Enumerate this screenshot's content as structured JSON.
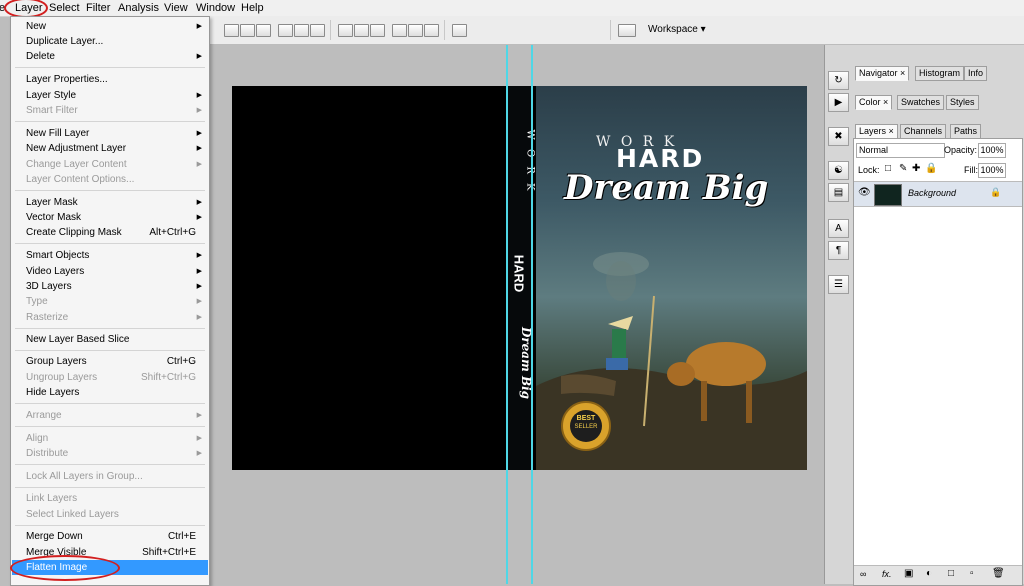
{
  "menubar": {
    "items": [
      "e",
      "Layer",
      "Select",
      "Filter",
      "Analysis",
      "View",
      "Window",
      "Help"
    ],
    "highlight_color": "#d21f1f"
  },
  "optionsbar": {
    "workspace_label": "Workspace ▾"
  },
  "layer_menu": {
    "items": [
      {
        "label": "New",
        "shortcut": "",
        "arrow": true,
        "disabled": false
      },
      {
        "label": "Duplicate Layer...",
        "shortcut": "",
        "arrow": false,
        "disabled": false
      },
      {
        "label": "Delete",
        "shortcut": "",
        "arrow": true,
        "disabled": false
      },
      {
        "label": "Layer Properties...",
        "shortcut": "",
        "arrow": false,
        "disabled": false
      },
      {
        "label": "Layer Style",
        "shortcut": "",
        "arrow": true,
        "disabled": false
      },
      {
        "label": "Smart Filter",
        "shortcut": "",
        "arrow": true,
        "disabled": true
      },
      {
        "label": "New Fill Layer",
        "shortcut": "",
        "arrow": true,
        "disabled": false
      },
      {
        "label": "New Adjustment Layer",
        "shortcut": "",
        "arrow": true,
        "disabled": false
      },
      {
        "label": "Change Layer Content",
        "shortcut": "",
        "arrow": true,
        "disabled": true
      },
      {
        "label": "Layer Content Options...",
        "shortcut": "",
        "arrow": false,
        "disabled": true
      },
      {
        "label": "Layer Mask",
        "shortcut": "",
        "arrow": true,
        "disabled": false
      },
      {
        "label": "Vector Mask",
        "shortcut": "",
        "arrow": true,
        "disabled": false
      },
      {
        "label": "Create Clipping Mask",
        "shortcut": "Alt+Ctrl+G",
        "arrow": false,
        "disabled": false
      },
      {
        "label": "Smart Objects",
        "shortcut": "",
        "arrow": true,
        "disabled": false
      },
      {
        "label": "Video Layers",
        "shortcut": "",
        "arrow": true,
        "disabled": false
      },
      {
        "label": "3D Layers",
        "shortcut": "",
        "arrow": true,
        "disabled": false
      },
      {
        "label": "Type",
        "shortcut": "",
        "arrow": true,
        "disabled": true
      },
      {
        "label": "Rasterize",
        "shortcut": "",
        "arrow": true,
        "disabled": true
      },
      {
        "label": "New Layer Based Slice",
        "shortcut": "",
        "arrow": false,
        "disabled": false
      },
      {
        "label": "Group Layers",
        "shortcut": "Ctrl+G",
        "arrow": false,
        "disabled": false
      },
      {
        "label": "Ungroup Layers",
        "shortcut": "Shift+Ctrl+G",
        "arrow": false,
        "disabled": true
      },
      {
        "label": "Hide Layers",
        "shortcut": "",
        "arrow": false,
        "disabled": false
      },
      {
        "label": "Arrange",
        "shortcut": "",
        "arrow": true,
        "disabled": true
      },
      {
        "label": "Align",
        "shortcut": "",
        "arrow": true,
        "disabled": true
      },
      {
        "label": "Distribute",
        "shortcut": "",
        "arrow": true,
        "disabled": true
      },
      {
        "label": "Lock All Layers in Group...",
        "shortcut": "",
        "arrow": false,
        "disabled": true
      },
      {
        "label": "Link Layers",
        "shortcut": "",
        "arrow": false,
        "disabled": true
      },
      {
        "label": "Select Linked Layers",
        "shortcut": "",
        "arrow": false,
        "disabled": true
      },
      {
        "label": "Merge Down",
        "shortcut": "Ctrl+E",
        "arrow": false,
        "disabled": false
      },
      {
        "label": "Merge Visible",
        "shortcut": "Shift+Ctrl+E",
        "arrow": false,
        "disabled": false
      },
      {
        "label": "Flatten Image",
        "shortcut": "",
        "arrow": false,
        "disabled": false,
        "highlighted": true
      }
    ]
  },
  "cover": {
    "work": "W O R K",
    "hard": "HARD",
    "dream": "Dream Big",
    "spine_work": "W O R K",
    "spine_hard": "HARD",
    "spine_dream": "Dream Big",
    "badge_best": "BEST",
    "badge_seller": "SELLER"
  },
  "panels": {
    "group1_tabs": [
      "Navigator ×",
      "Histogram",
      "Info"
    ],
    "group2_tabs": [
      "Color ×",
      "Swatches",
      "Styles"
    ],
    "layers_tabs": [
      "Layers ×",
      "Channels",
      "Paths"
    ],
    "blend_mode": "Normal",
    "opacity_label": "Opacity:",
    "opacity_value": "100%",
    "lock_label": "Lock:",
    "fill_label": "Fill:",
    "fill_value": "100%",
    "layer_name": "Background"
  }
}
